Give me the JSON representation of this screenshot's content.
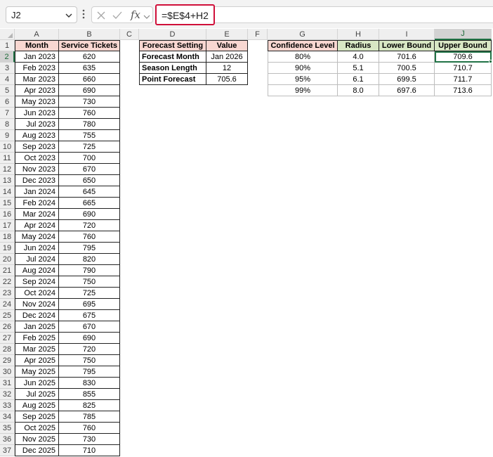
{
  "formula_bar": {
    "name_box": "J2",
    "formula": "=$E$4+H2",
    "fx_label": "fx"
  },
  "sheet": {
    "columns": [
      "A",
      "B",
      "C",
      "D",
      "E",
      "F",
      "G",
      "H",
      "I",
      "J"
    ],
    "selected_column": "J",
    "selected_row": 2,
    "row_count": 37,
    "active_cell": "J2"
  },
  "table_main": {
    "headers": [
      "Month",
      "Service Tickets"
    ],
    "rows": [
      [
        "Jan 2023",
        "620"
      ],
      [
        "Feb 2023",
        "635"
      ],
      [
        "Mar 2023",
        "660"
      ],
      [
        "Apr 2023",
        "690"
      ],
      [
        "May 2023",
        "730"
      ],
      [
        "Jun 2023",
        "760"
      ],
      [
        "Jul 2023",
        "780"
      ],
      [
        "Aug 2023",
        "755"
      ],
      [
        "Sep 2023",
        "725"
      ],
      [
        "Oct 2023",
        "700"
      ],
      [
        "Nov 2023",
        "670"
      ],
      [
        "Dec 2023",
        "650"
      ],
      [
        "Jan 2024",
        "645"
      ],
      [
        "Feb 2024",
        "665"
      ],
      [
        "Mar 2024",
        "690"
      ],
      [
        "Apr 2024",
        "720"
      ],
      [
        "May 2024",
        "760"
      ],
      [
        "Jun 2024",
        "795"
      ],
      [
        "Jul 2024",
        "820"
      ],
      [
        "Aug 2024",
        "790"
      ],
      [
        "Sep 2024",
        "750"
      ],
      [
        "Oct 2024",
        "725"
      ],
      [
        "Nov 2024",
        "695"
      ],
      [
        "Dec 2024",
        "675"
      ],
      [
        "Jan 2025",
        "670"
      ],
      [
        "Feb 2025",
        "690"
      ],
      [
        "Mar 2025",
        "720"
      ],
      [
        "Apr 2025",
        "750"
      ],
      [
        "May 2025",
        "795"
      ],
      [
        "Jun 2025",
        "830"
      ],
      [
        "Jul 2025",
        "855"
      ],
      [
        "Aug 2025",
        "825"
      ],
      [
        "Sep 2025",
        "785"
      ],
      [
        "Oct 2025",
        "760"
      ],
      [
        "Nov 2025",
        "730"
      ],
      [
        "Dec 2025",
        "710"
      ]
    ]
  },
  "table_settings": {
    "headers": [
      "Forecast Setting",
      "Value"
    ],
    "rows": [
      [
        "Forecast Month",
        "Jan 2026"
      ],
      [
        "Season Length",
        "12"
      ],
      [
        "Point Forecast",
        "705.6"
      ]
    ]
  },
  "table_confidence": {
    "headers": [
      "Confidence Level",
      "Radius",
      "Lower Bound",
      "Upper Bound"
    ],
    "rows": [
      [
        "80%",
        "4.0",
        "701.6",
        "709.6"
      ],
      [
        "90%",
        "5.1",
        "700.5",
        "710.7"
      ],
      [
        "95%",
        "6.1",
        "699.5",
        "711.7"
      ],
      [
        "99%",
        "8.0",
        "697.6",
        "713.6"
      ]
    ]
  },
  "colors": {
    "header_pink": "#f8d7d1",
    "header_green": "#d8e7c4",
    "selection_green": "#217346",
    "formula_highlight": "#d0103a"
  }
}
